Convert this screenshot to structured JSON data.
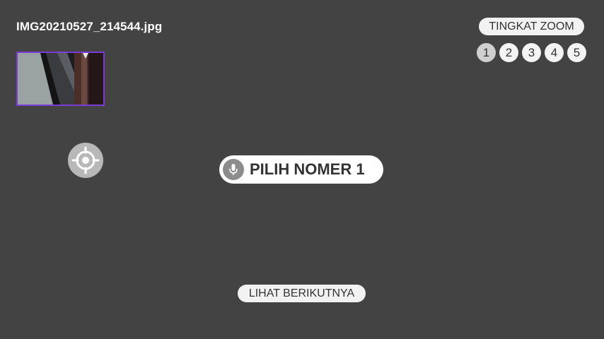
{
  "file": {
    "name": "IMG20210527_214544.jpg"
  },
  "zoom": {
    "label": "TINGKAT ZOOM",
    "levels": [
      "1",
      "2",
      "3",
      "4",
      "5"
    ],
    "active_index": 0
  },
  "voice_prompt": {
    "icon": "microphone-icon",
    "text": "PILIH NOMER 1"
  },
  "locate": {
    "icon": "crosshair-icon"
  },
  "navigation": {
    "next_label": "LIHAT BERIKUTNYA"
  },
  "colors": {
    "background": "#434343",
    "thumbnail_border": "#7a3bd6",
    "pill_background": "#f2f2f2",
    "text_dark": "#333333"
  }
}
